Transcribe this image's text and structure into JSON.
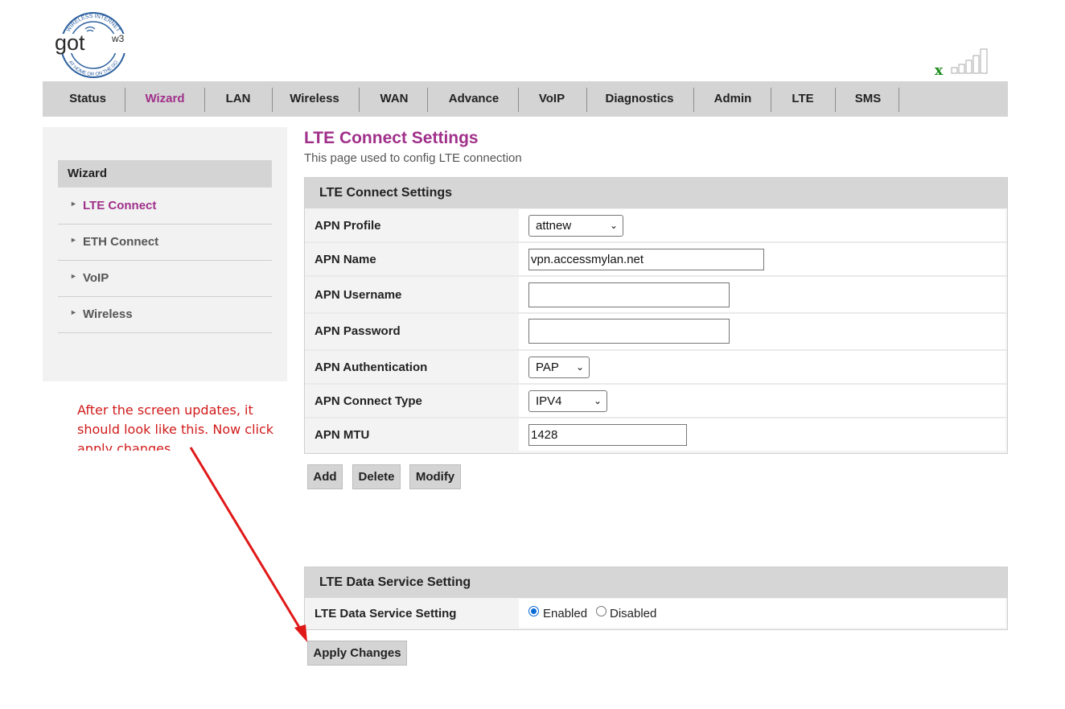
{
  "logo": {
    "text": "got",
    "superscript": "w3",
    "ring_text_top": "WIRELESS INTERNET",
    "ring_text_bottom": "AT HOME OR ON THE GO"
  },
  "signal": {
    "status_mark": "x",
    "status_color": "#1a8a1a"
  },
  "nav": {
    "items": [
      {
        "label": "Status"
      },
      {
        "label": "Wizard",
        "active": true
      },
      {
        "label": "LAN"
      },
      {
        "label": "Wireless"
      },
      {
        "label": "WAN"
      },
      {
        "label": "Advance"
      },
      {
        "label": "VoIP"
      },
      {
        "label": "Diagnostics"
      },
      {
        "label": "Admin"
      },
      {
        "label": "LTE"
      },
      {
        "label": "SMS"
      }
    ],
    "active_color": "#a0308a"
  },
  "sidebar": {
    "heading": "Wizard",
    "items": [
      {
        "label": "LTE Connect",
        "active": true
      },
      {
        "label": "ETH Connect"
      },
      {
        "label": "VoIP"
      },
      {
        "label": "Wireless"
      }
    ]
  },
  "page": {
    "title": "LTE Connect Settings",
    "description": "This page used to config LTE connection"
  },
  "lte_settings": {
    "heading": "LTE Connect Settings",
    "fields": {
      "apn_profile": {
        "label": "APN Profile",
        "value": "attnew"
      },
      "apn_name": {
        "label": "APN Name",
        "value": "vpn.accessmylan.net"
      },
      "apn_username": {
        "label": "APN Username",
        "value": ""
      },
      "apn_password": {
        "label": "APN Password",
        "value": ""
      },
      "apn_auth": {
        "label": "APN Authentication",
        "value": "PAP"
      },
      "apn_connect_type": {
        "label": "APN Connect Type",
        "value": "IPV4"
      },
      "apn_mtu": {
        "label": "APN MTU",
        "value": "1428"
      }
    },
    "buttons": {
      "add": "Add",
      "delete": "Delete",
      "modify": "Modify"
    }
  },
  "data_service": {
    "heading": "LTE Data Service Setting",
    "label": "LTE Data Service Setting",
    "enabled_label": "Enabled",
    "disabled_label": "Disabled",
    "selected": "enabled",
    "apply_label": "Apply Changes"
  },
  "annotation": {
    "text": "After the screen updates, it should look like this.  Now click apply changes",
    "color": "#d11a1a"
  }
}
